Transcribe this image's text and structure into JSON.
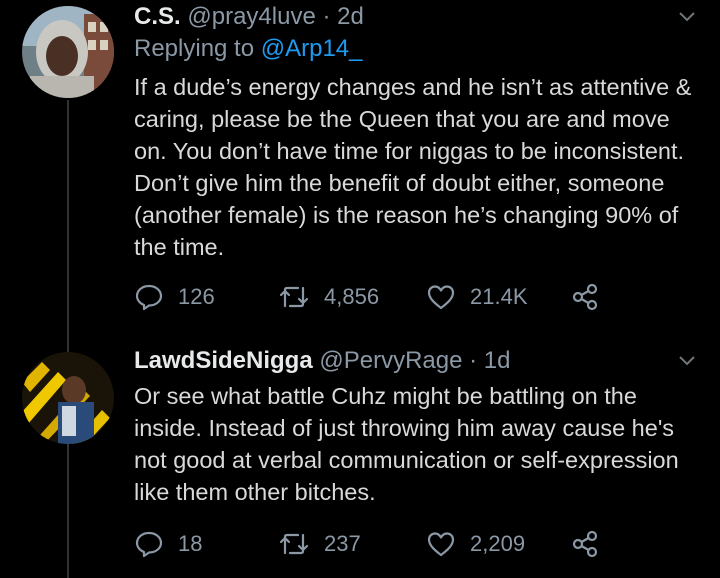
{
  "colors": {
    "background": "#000000",
    "text": "#d9d9d9",
    "muted": "#8b98a5",
    "link": "#1d9bf0",
    "thread_line": "#2f3336"
  },
  "tweets": [
    {
      "name": "C.S.",
      "handle": "@pray4luve",
      "separator": "·",
      "time": "2d",
      "reply_label": "Replying to",
      "reply_mention": "@Arp14_",
      "text": "If a dude’s energy changes and he isn’t as attentive & caring, please be the Queen that you are and move on. You don’t have time for niggas to be inconsistent. Don’t give him the benefit of doubt either, someone (another female) is the reason he’s changing 90% of the time.",
      "replies": "126",
      "retweets": "4,856",
      "likes": "21.4K",
      "icons": [
        "reply-icon",
        "retweet-icon",
        "like-icon",
        "share-icon",
        "chevron-down-icon"
      ]
    },
    {
      "name": "LawdSideNigga",
      "handle": "@PervyRage",
      "separator": "·",
      "time": "1d",
      "text": "Or see what battle Cuhz might be battling on the inside. Instead of just throwing him away cause he's not good at verbal communication or self-expression like them other bitches.",
      "replies": "18",
      "retweets": "237",
      "likes": "2,209",
      "icons": [
        "reply-icon",
        "retweet-icon",
        "like-icon",
        "share-icon",
        "chevron-down-icon"
      ]
    }
  ]
}
